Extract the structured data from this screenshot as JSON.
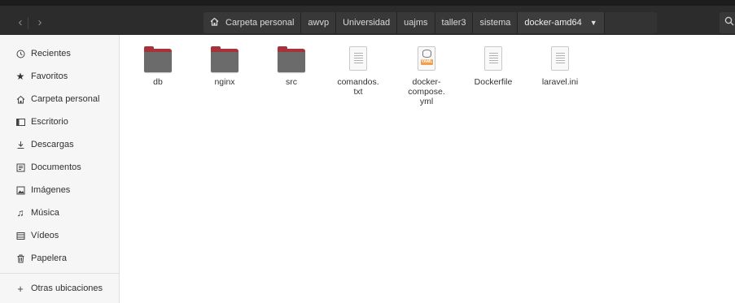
{
  "header": {
    "back_icon": "chevron-left",
    "forward_icon": "chevron-right",
    "breadcrumbs": [
      "Carpeta personal",
      "awvp",
      "Universidad",
      "uajms",
      "taller3",
      "sistema",
      "docker-amd64"
    ],
    "search_icon": "search"
  },
  "sidebar": {
    "items": [
      {
        "label": "Recientes",
        "icon": "clock"
      },
      {
        "label": "Favoritos",
        "icon": "star"
      },
      {
        "label": "Carpeta personal",
        "icon": "home"
      },
      {
        "label": "Escritorio",
        "icon": "desktop"
      },
      {
        "label": "Descargas",
        "icon": "download"
      },
      {
        "label": "Documentos",
        "icon": "document"
      },
      {
        "label": "Imágenes",
        "icon": "image"
      },
      {
        "label": "Música",
        "icon": "music"
      },
      {
        "label": "Vídeos",
        "icon": "video"
      },
      {
        "label": "Papelera",
        "icon": "trash"
      }
    ],
    "other": {
      "label": "Otras ubicaciones",
      "icon": "plus"
    }
  },
  "files": [
    {
      "name": "db",
      "type": "folder"
    },
    {
      "name": "nginx",
      "type": "folder"
    },
    {
      "name": "src",
      "type": "folder"
    },
    {
      "name": "comandos.\ntxt",
      "type": "text"
    },
    {
      "name": "docker-\ncompose.\nyml",
      "type": "yaml",
      "badge": "YAML"
    },
    {
      "name": "Dockerfile",
      "type": "text"
    },
    {
      "name": "laravel.ini",
      "type": "text"
    }
  ],
  "colors": {
    "folder_accent": "#a8323a",
    "folder_body": "#6b6b6b",
    "yaml_badge": "#f0a050",
    "header_bg": "#2c2c2c"
  }
}
